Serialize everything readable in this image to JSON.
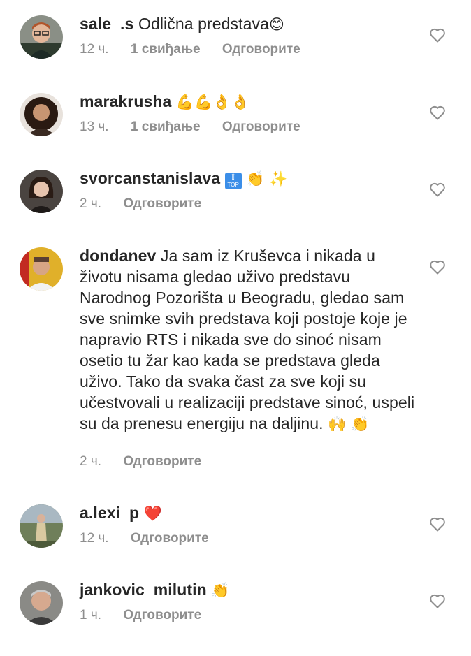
{
  "comments": [
    {
      "username": "sale_.s",
      "text": "Odlična predstava",
      "emoji": "😊",
      "time": "12 ч.",
      "likes": "1 свиђање",
      "reply": "Одговорите",
      "avatar": "avatar-man-glasses"
    },
    {
      "username": "marakrusha",
      "text": "",
      "emoji": "💪💪👌👌",
      "time": "13 ч.",
      "likes": "1 свиђање",
      "reply": "Одговорите",
      "avatar": "avatar-woman-curly"
    },
    {
      "username": "svorcanstanislava",
      "text": "",
      "emoji": "👏 ✨",
      "top_badge": "TOP",
      "time": "2 ч.",
      "likes": "",
      "reply": "Одговорите",
      "avatar": "avatar-woman-dark"
    },
    {
      "username": "dondanev",
      "text": "Ja sam iz Kruševca i nikada u životu nisama gledao uživo predstavu Narodnog Pozorišta u Beogradu, gledao sam sve snimke svih predstava koji postoje koje je napravio RTS i nikada sve do sinoć nisam osetio tu žar kao kada se predstava gleda uživo. Tako da svaka čast za sve koji su učestvovali u realizaciji predstave sinoć, uspeli su da prenesu energiju na daljinu.",
      "emoji": "🙌 👏",
      "time": "2 ч.",
      "likes": "",
      "reply": "Одговорите",
      "avatar": "avatar-man-yellow"
    },
    {
      "username": "a.lexi_p",
      "text": "",
      "emoji": "❤️",
      "time": "12 ч.",
      "likes": "",
      "reply": "Одговорите",
      "avatar": "avatar-woman-outdoor"
    },
    {
      "username": "jankovic_milutin",
      "text": "",
      "emoji": "👏",
      "time": "1 ч.",
      "likes": "",
      "reply": "Одговорите",
      "avatar": "avatar-older-man"
    }
  ],
  "icons": {
    "like": "heart-outline-icon"
  },
  "colors": {
    "meta": "#8e8e8e",
    "text": "#262626",
    "heart_outline": "#8e8e8e",
    "red_heart": "#e0245e"
  }
}
